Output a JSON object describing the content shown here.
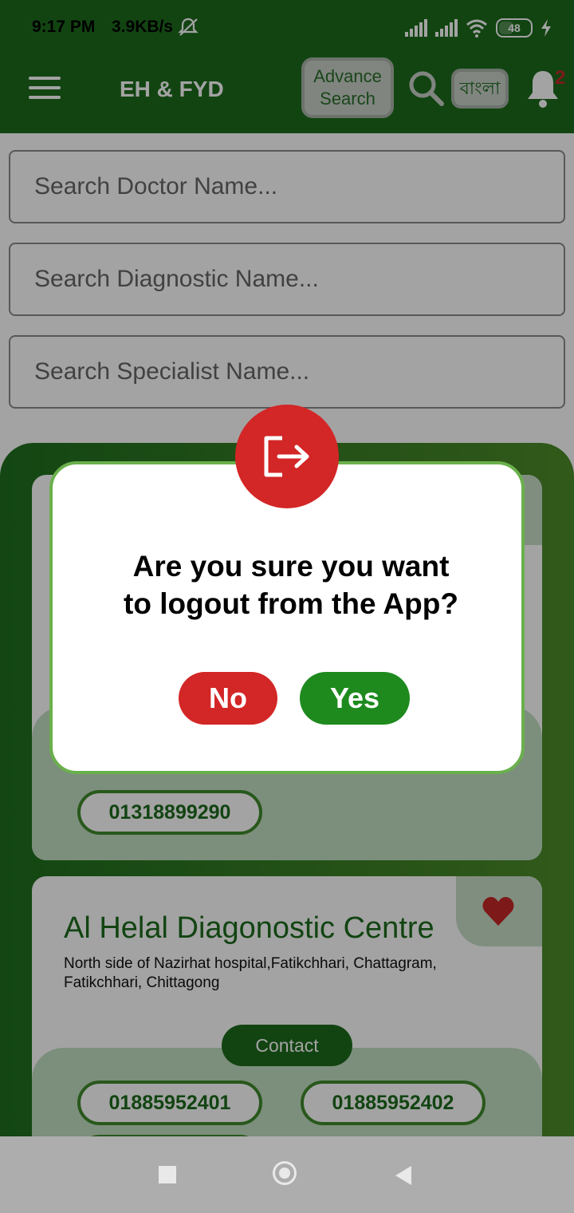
{
  "status_bar": {
    "time": "9:17 PM",
    "speed": "3.9KB/s",
    "battery": "48",
    "icons": [
      "mute-icon",
      "signal-icon",
      "signal-icon",
      "wifi-icon",
      "battery-icon",
      "charging-icon"
    ]
  },
  "app_bar": {
    "title": "EH & FYD",
    "advance_search_line1": "Advance",
    "advance_search_line2": "Search",
    "language_label": "বাংলা",
    "notification_count": "2",
    "icons": [
      "menu-icon",
      "search-icon",
      "bell-icon"
    ]
  },
  "search": {
    "doctor_placeholder": "Search Doctor Name...",
    "diagnostic_placeholder": "Search Diagnostic Name...",
    "specialist_placeholder": "Search Specialist Name..."
  },
  "cards": [
    {
      "phones": [
        "01318899290"
      ]
    },
    {
      "name": "Al Helal Diagonostic Centre",
      "address": "North side of Nazirhat hospital,Fatikchhari, Chattagram, Fatikchhari, Chittagong",
      "contact_label": "Contact",
      "phones": [
        "01885952401",
        "01885952402"
      ]
    }
  ],
  "dialog": {
    "message_line1": "Are you sure you want",
    "message_line2": "to logout from the App?",
    "no_label": "No",
    "yes_label": "Yes",
    "icon": "logout-icon"
  },
  "colors": {
    "primary_green": "#1d6b1d",
    "accent_red": "#d32626",
    "yes_green": "#1e8a1e"
  }
}
